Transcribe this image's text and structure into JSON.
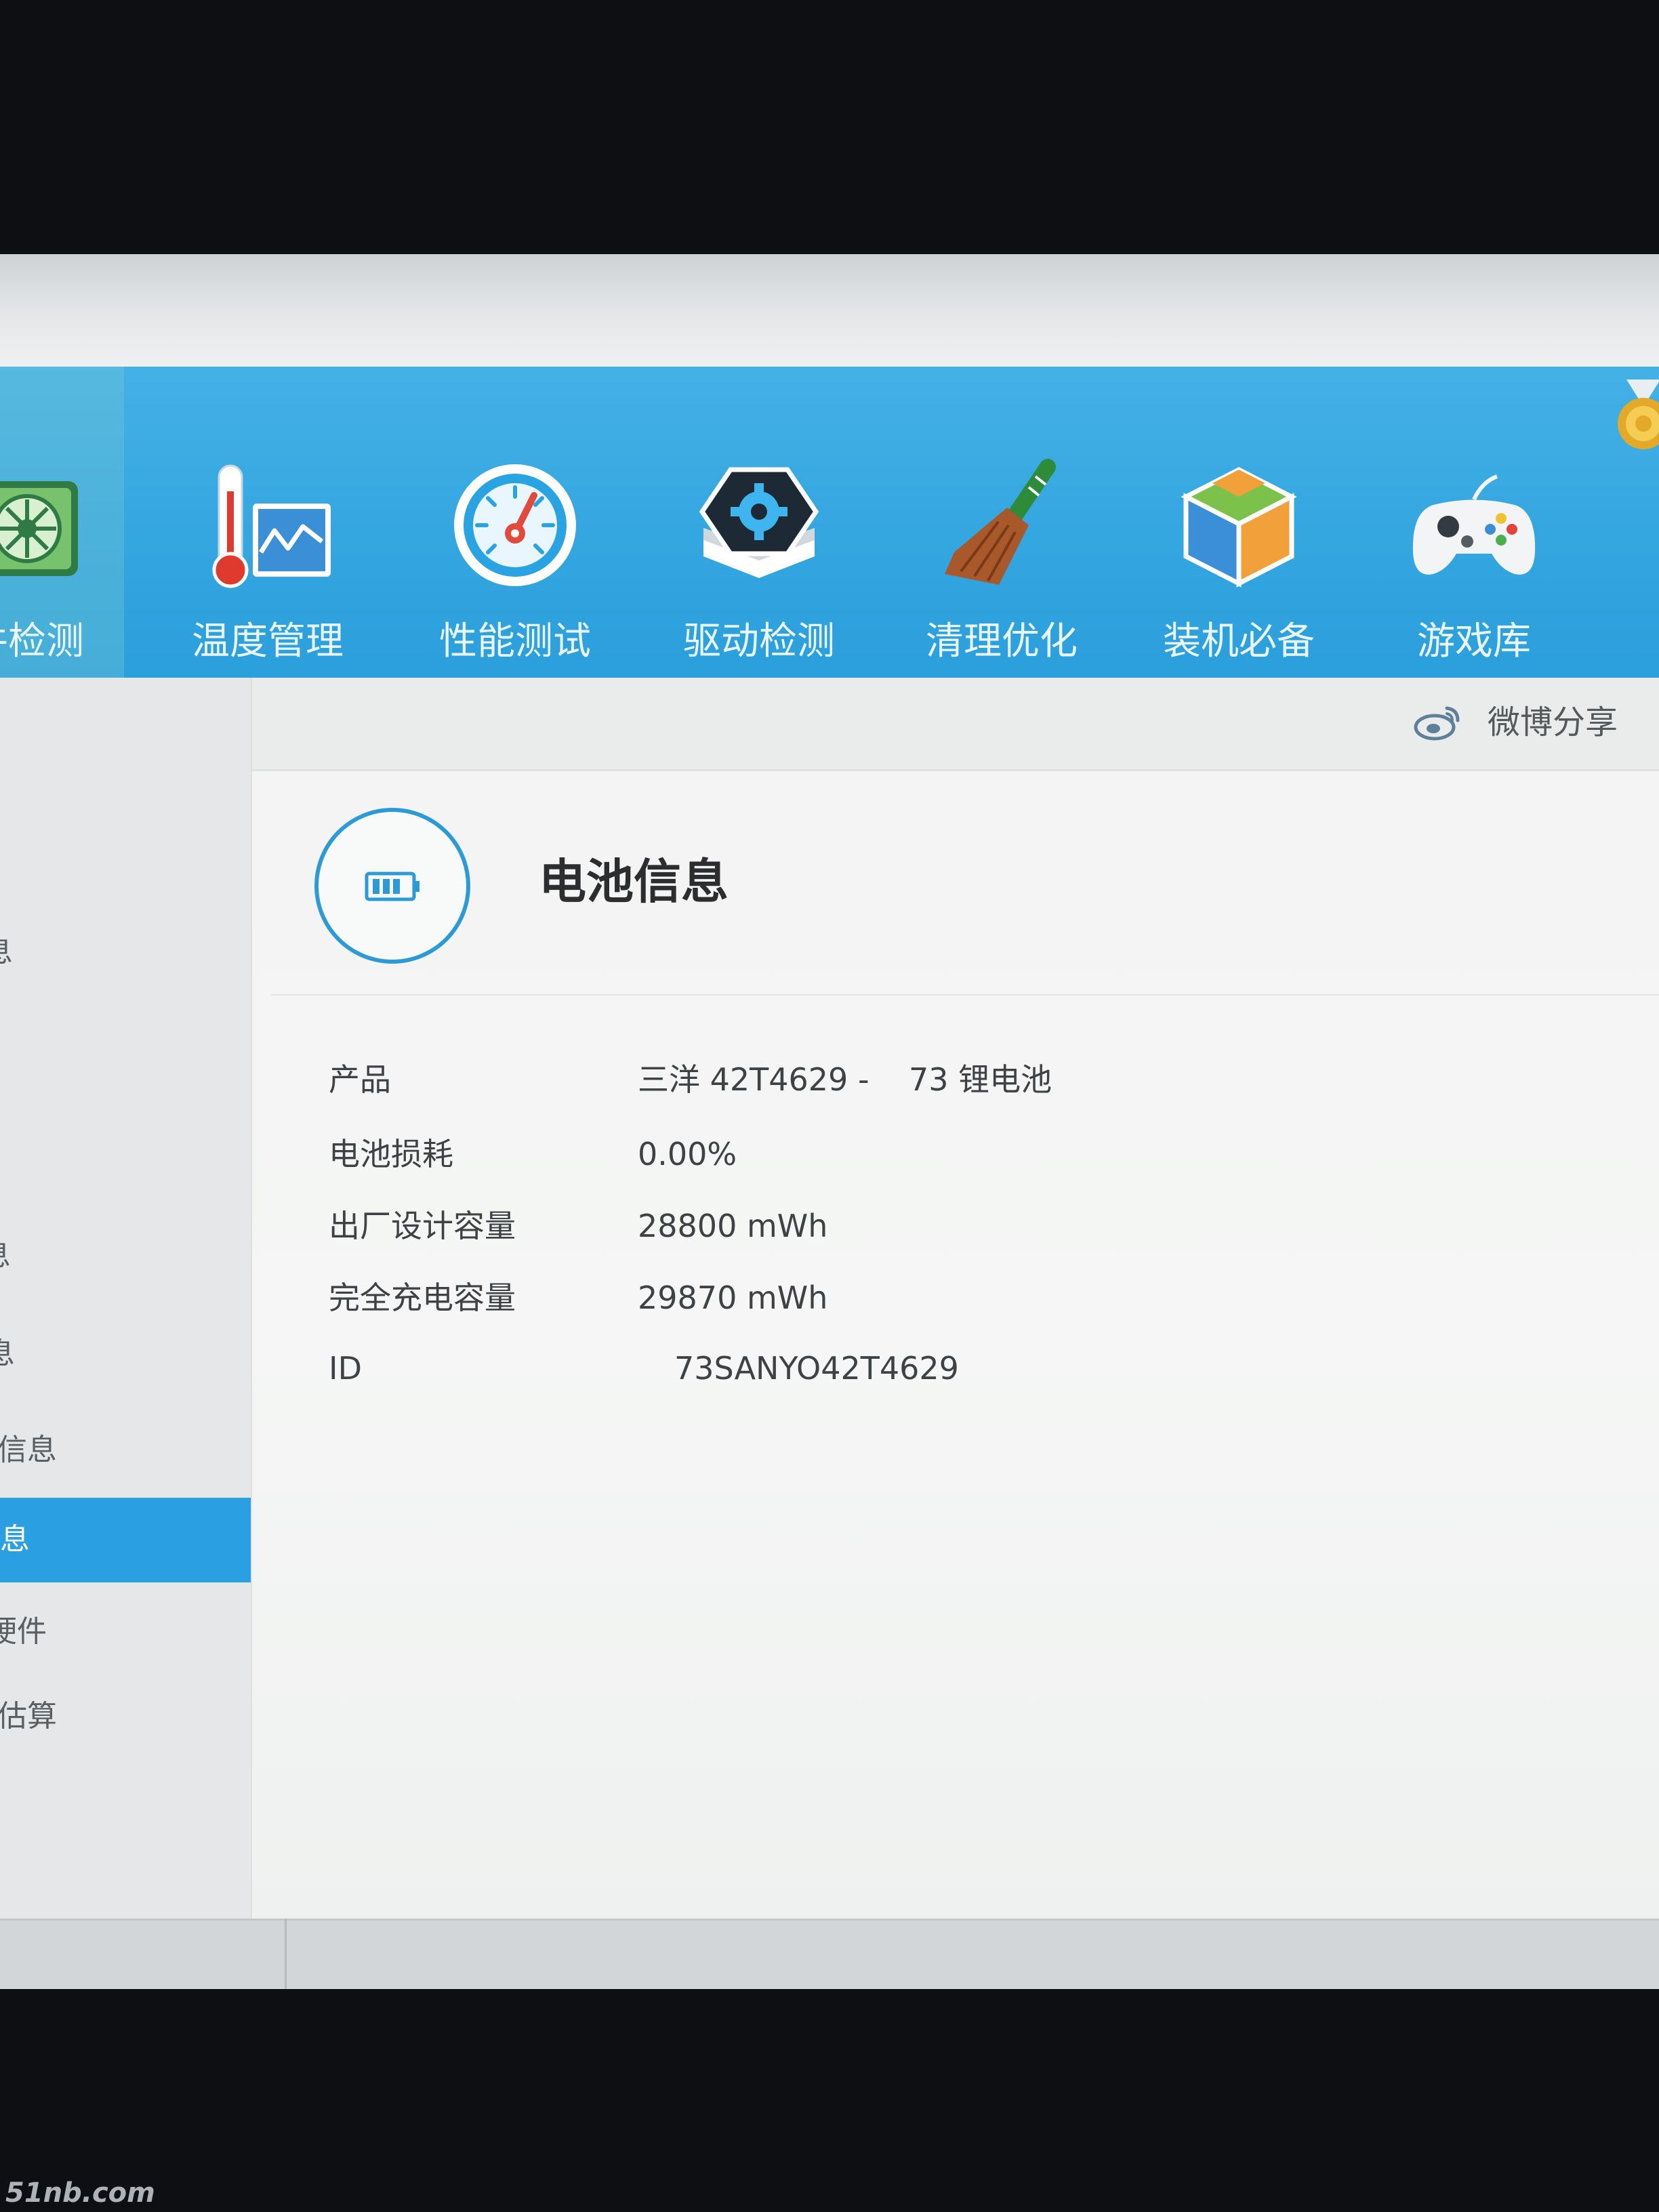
{
  "toolbar": {
    "selected_index": 0,
    "items": [
      {
        "label": "件检测",
        "icon": "hardware-check-icon"
      },
      {
        "label": "温度管理",
        "icon": "thermometer-chart-icon"
      },
      {
        "label": "性能测试",
        "icon": "speedometer-icon"
      },
      {
        "label": "驱动检测",
        "icon": "driver-gear-icon"
      },
      {
        "label": "清理优化",
        "icon": "broom-icon"
      },
      {
        "label": "装机必备",
        "icon": "cube-icon"
      },
      {
        "label": "游戏库",
        "icon": "gamepad-icon"
      }
    ],
    "corner_icon": "medal-icon"
  },
  "sidebar": {
    "items": [
      {
        "label": "息"
      },
      {
        "label": "息"
      },
      {
        "label": "息"
      },
      {
        "label": "信息"
      },
      {
        "label": "息",
        "selected": true
      },
      {
        "label": "硬件"
      },
      {
        "label": "估算"
      }
    ]
  },
  "share": {
    "label": "微博分享",
    "icon": "weibo-icon"
  },
  "panel": {
    "title": "电池信息",
    "icon": "battery-icon",
    "rows": [
      {
        "label": "产品",
        "value": "三洋 42T4629 -    73 锂电池"
      },
      {
        "label": "电池损耗",
        "value": "0.00%"
      },
      {
        "label": "出厂设计容量",
        "value": "28800 mWh"
      },
      {
        "label": "完全充电容量",
        "value": "29870 mWh"
      },
      {
        "label": "ID",
        "value": "73SANYO42T4629"
      }
    ]
  },
  "watermark": "51nb.com",
  "colors": {
    "toolbar": "#34a6e0",
    "accent": "#2c9ad6",
    "selected_sidebar": "#2a9fe2",
    "panel_background": "#f3f4f3"
  }
}
